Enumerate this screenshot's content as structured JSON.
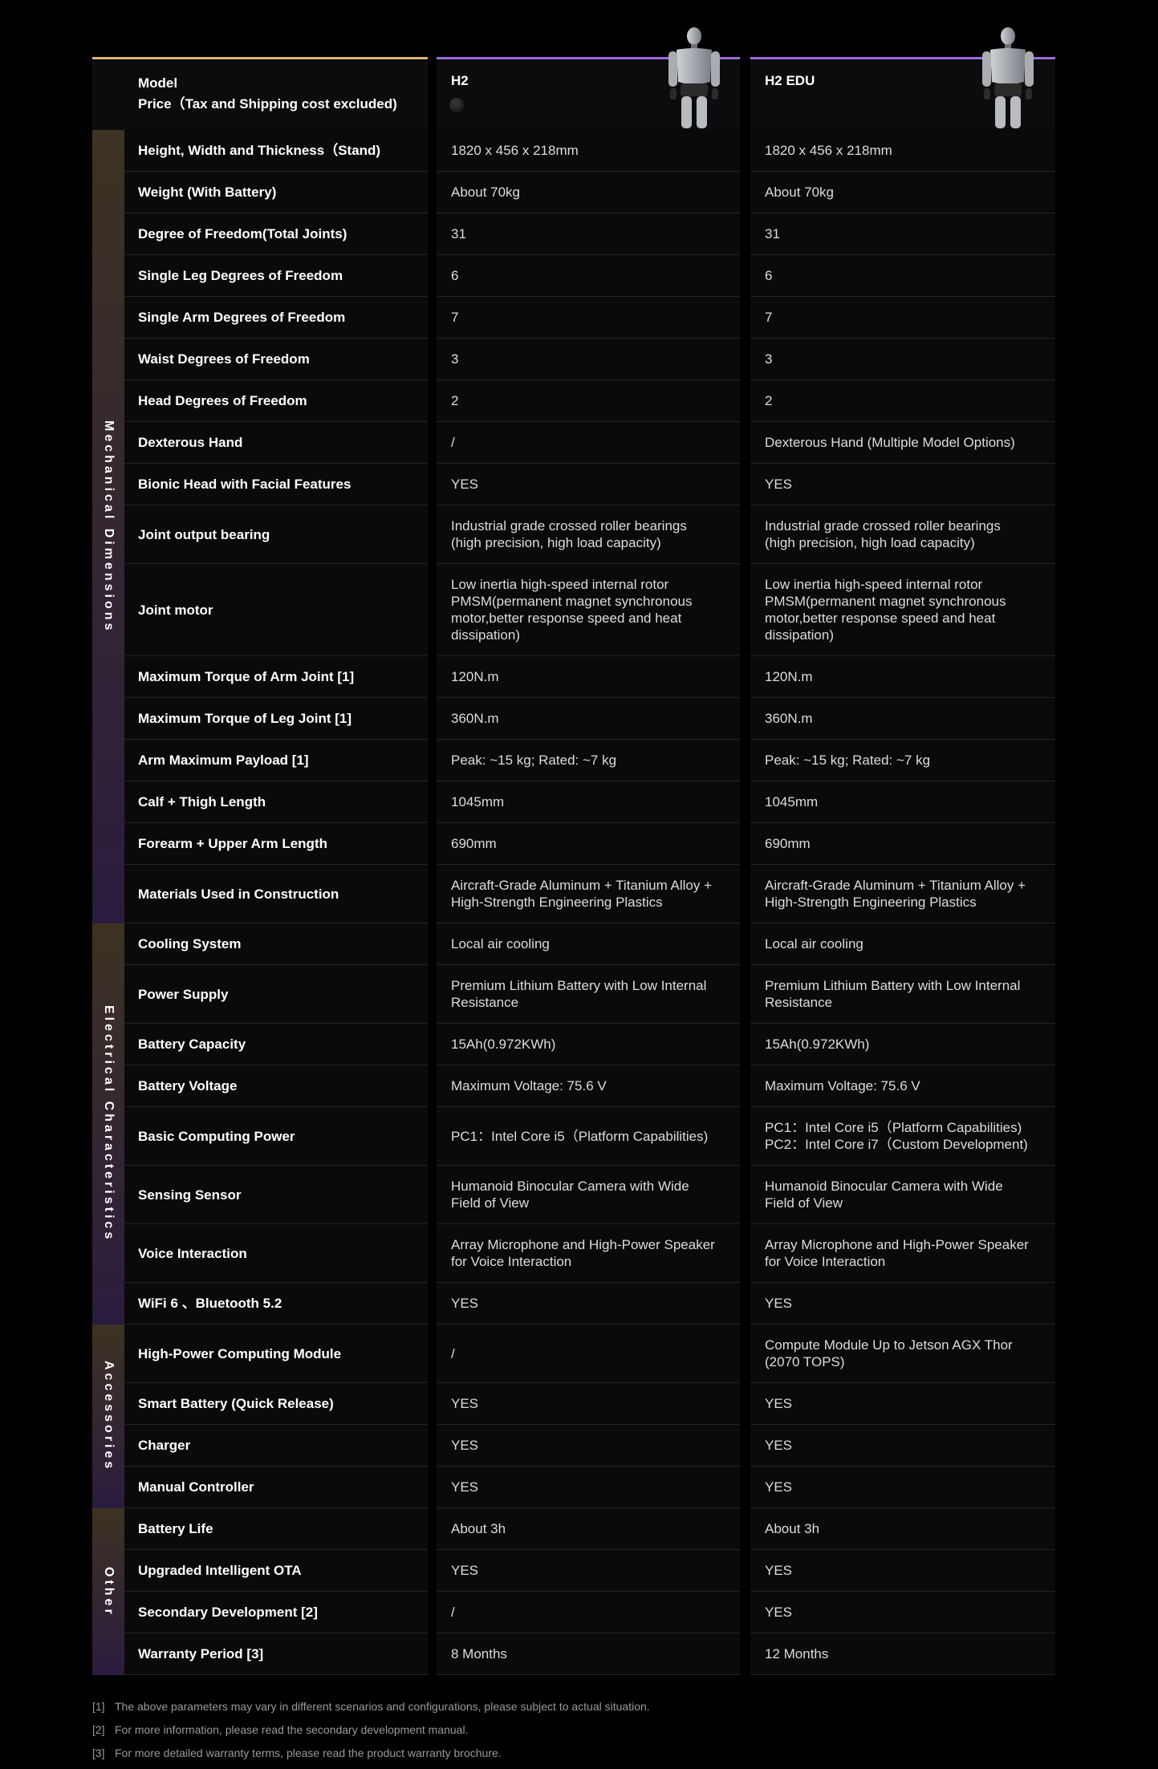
{
  "header": {
    "label_title": "Model",
    "label_price": "Price（Tax and Shipping cost excluded)",
    "models": [
      {
        "name": "H2",
        "image": "humanoid-robot-render"
      },
      {
        "name": "H2 EDU",
        "image": "humanoid-robot-render"
      }
    ]
  },
  "groups": [
    {
      "label": "Mechanical Dimensions",
      "gradient": [
        "#3e3223",
        "#2a1c3e"
      ],
      "rows": [
        {
          "label": "Height, Width and Thickness（Stand)",
          "v1": "1820 x 456 x 218mm",
          "v2": "1820 x 456 x 218mm"
        },
        {
          "label": "Weight (With Battery)",
          "v1": "About 70kg",
          "v2": "About 70kg"
        },
        {
          "label": "Degree of Freedom(Total Joints)",
          "v1": "31",
          "v2": "31"
        },
        {
          "label": "Single Leg Degrees of Freedom",
          "v1": "6",
          "v2": "6"
        },
        {
          "label": "Single Arm Degrees of Freedom",
          "v1": "7",
          "v2": "7"
        },
        {
          "label": "Waist Degrees of Freedom",
          "v1": "3",
          "v2": "3"
        },
        {
          "label": "Head Degrees of Freedom",
          "v1": "2",
          "v2": "2"
        },
        {
          "label": "Dexterous Hand",
          "v1": "/",
          "v2": "Dexterous Hand (Multiple Model Options)"
        },
        {
          "label": "Bionic Head with Facial Features",
          "v1": "YES",
          "v2": "YES"
        },
        {
          "label": "Joint output bearing",
          "v1": "Industrial grade crossed roller bearings\n(high precision, high load capacity)",
          "v2": "Industrial grade crossed roller bearings\n(high precision, high load capacity)"
        },
        {
          "label": "Joint motor",
          "v1": "Low inertia high-speed internal rotor\nPMSM(permanent magnet synchronous\nmotor,better response speed and heat\ndissipation)",
          "v2": "Low inertia high-speed internal rotor\nPMSM(permanent magnet synchronous\nmotor,better response speed and heat\ndissipation)"
        },
        {
          "label": "Maximum Torque of Arm Joint [1]",
          "v1": "120N.m",
          "v2": "120N.m"
        },
        {
          "label": "Maximum Torque of Leg Joint [1]",
          "v1": "360N.m",
          "v2": "360N.m"
        },
        {
          "label": "Arm Maximum Payload [1]",
          "v1": "Peak: ~15 kg; Rated: ~7 kg",
          "v2": "Peak: ~15 kg; Rated: ~7 kg"
        },
        {
          "label": "Calf + Thigh Length",
          "v1": "1045mm",
          "v2": "1045mm"
        },
        {
          "label": "Forearm + Upper Arm Length",
          "v1": "690mm",
          "v2": "690mm"
        },
        {
          "label": "Materials Used in Construction",
          "v1": "Aircraft-Grade Aluminum + Titanium Alloy +\nHigh-Strength Engineering Plastics",
          "v2": "Aircraft-Grade Aluminum + Titanium Alloy +\nHigh-Strength Engineering Plastics"
        }
      ]
    },
    {
      "label": "Electrical Characteristics",
      "gradient": [
        "#3e3223",
        "#2a1c3e"
      ],
      "rows": [
        {
          "label": "Cooling System",
          "v1": "Local air cooling",
          "v2": "Local air cooling"
        },
        {
          "label": "Power Supply",
          "v1": "Premium Lithium Battery with Low Internal\nResistance",
          "v2": "Premium Lithium Battery with Low Internal\nResistance"
        },
        {
          "label": "Battery Capacity",
          "v1": "15Ah(0.972KWh)",
          "v2": "15Ah(0.972KWh)"
        },
        {
          "label": "Battery Voltage",
          "v1": "Maximum Voltage: 75.6 V",
          "v2": "Maximum Voltage: 75.6 V"
        },
        {
          "label": "Basic Computing Power",
          "v1": "PC1：Intel Core i5（Platform Capabilities)",
          "v2": "PC1：Intel Core i5（Platform Capabilities)\nPC2：Intel Core i7（Custom Development)"
        },
        {
          "label": "Sensing Sensor",
          "v1": "Humanoid Binocular Camera with Wide\nField of View",
          "v2": "Humanoid Binocular Camera with Wide\nField of View"
        },
        {
          "label": "Voice Interaction",
          "v1": "Array Microphone and High-Power Speaker\nfor Voice Interaction",
          "v2": "Array Microphone and High-Power Speaker\nfor Voice Interaction"
        },
        {
          "label": "WiFi 6 、Bluetooth 5.2",
          "v1": "YES",
          "v2": "YES"
        }
      ]
    },
    {
      "label": "Accessories",
      "gradient": [
        "#3e3223",
        "#2a1c3e"
      ],
      "rows": [
        {
          "label": "High-Power Computing Module",
          "v1": "/",
          "v2": "Compute Module Up to Jetson AGX Thor\n(2070 TOPS)"
        },
        {
          "label": "Smart Battery (Quick Release)",
          "v1": "YES",
          "v2": "YES"
        },
        {
          "label": "Charger",
          "v1": "YES",
          "v2": "YES"
        },
        {
          "label": "Manual Controller",
          "v1": "YES",
          "v2": "YES"
        }
      ]
    },
    {
      "label": "Other",
      "gradient": [
        "#3e3223",
        "#2a1c3e"
      ],
      "rows": [
        {
          "label": "Battery Life",
          "v1": "About 3h",
          "v2": "About 3h"
        },
        {
          "label": "Upgraded Intelligent OTA",
          "v1": "YES",
          "v2": "YES"
        },
        {
          "label": "Secondary Development [2]",
          "v1": "/",
          "v2": "YES"
        },
        {
          "label": "Warranty Period [3]",
          "v1": "8 Months",
          "v2": "12 Months"
        }
      ]
    }
  ],
  "footnotes": [
    {
      "mark": "[1]",
      "text": "The above parameters may vary in different scenarios and configurations, please subject to actual situation."
    },
    {
      "mark": "[2]",
      "text": "For more information, please read the secondary development manual."
    },
    {
      "mark": "[3]",
      "text": "For more detailed warranty terms, please read the product warranty brochure."
    }
  ]
}
